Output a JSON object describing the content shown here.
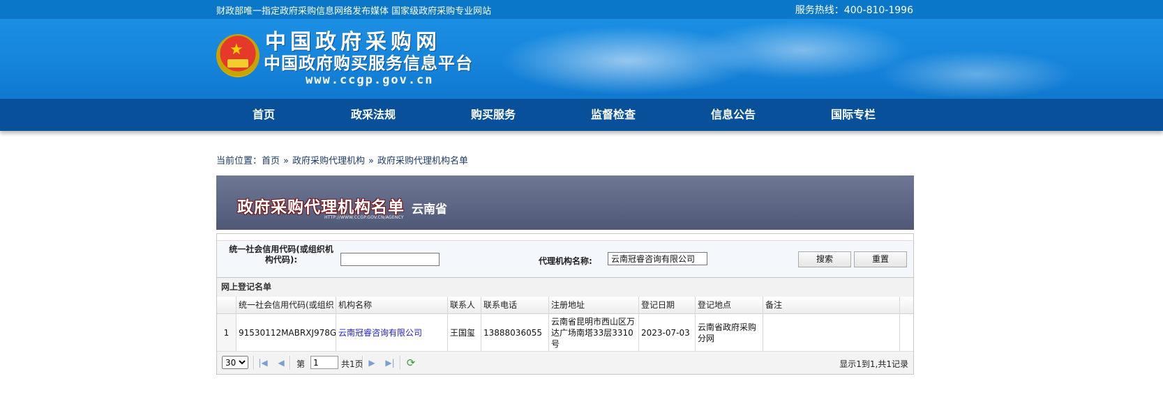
{
  "header": {
    "slogan": "财政部唯一指定政府采购信息网络发布媒体 国家级政府采购专业网站",
    "hotline": "服务热线：400-810-1996",
    "site_title": "中国政府采购网",
    "site_subtitle": "中国政府购买服务信息平台",
    "site_url": "www.ccgp.gov.cn"
  },
  "nav": [
    "首页",
    "政采法规",
    "购买服务",
    "监督检查",
    "信息公告",
    "国际专栏"
  ],
  "breadcrumb": {
    "prefix": "当前位置：",
    "items": [
      "首页",
      "政府采购代理机构",
      "政府采购代理机构名单"
    ],
    "separator": "»"
  },
  "page_banner": {
    "title": "政府采购代理机构名单",
    "province": "云南省",
    "url": "HTTP://WWW.CCGP.GOV.CN/AGENCY"
  },
  "search": {
    "code_label": "统一社会信用代码(或组织机构代码):",
    "code_value": "",
    "name_label": "代理机构名称:",
    "name_value": "云南冠睿咨询有限公司",
    "search_button": "搜索",
    "reset_button": "重置"
  },
  "grid": {
    "caption": "网上登记名单",
    "columns": [
      "统一社会信用代码(或组织",
      "机构名称",
      "联系人",
      "联系电话",
      "注册地址",
      "登记日期",
      "登记地点",
      "备注"
    ],
    "rows": [
      {
        "num": "1",
        "code": "91530112MABRXJ978G",
        "name": "云南冠睿咨询有限公司",
        "contact": "王国玺",
        "phone": "13888036055",
        "address": "云南省昆明市西山区万达广场南塔33层3310号",
        "date": "2023-07-03",
        "place": "云南省政府采购分网",
        "remark": ""
      }
    ]
  },
  "pager": {
    "page_size": "30",
    "page_label_before": "第",
    "page_value": "1",
    "page_label_after": "共1页",
    "info": "显示1到1,共1记录"
  }
}
